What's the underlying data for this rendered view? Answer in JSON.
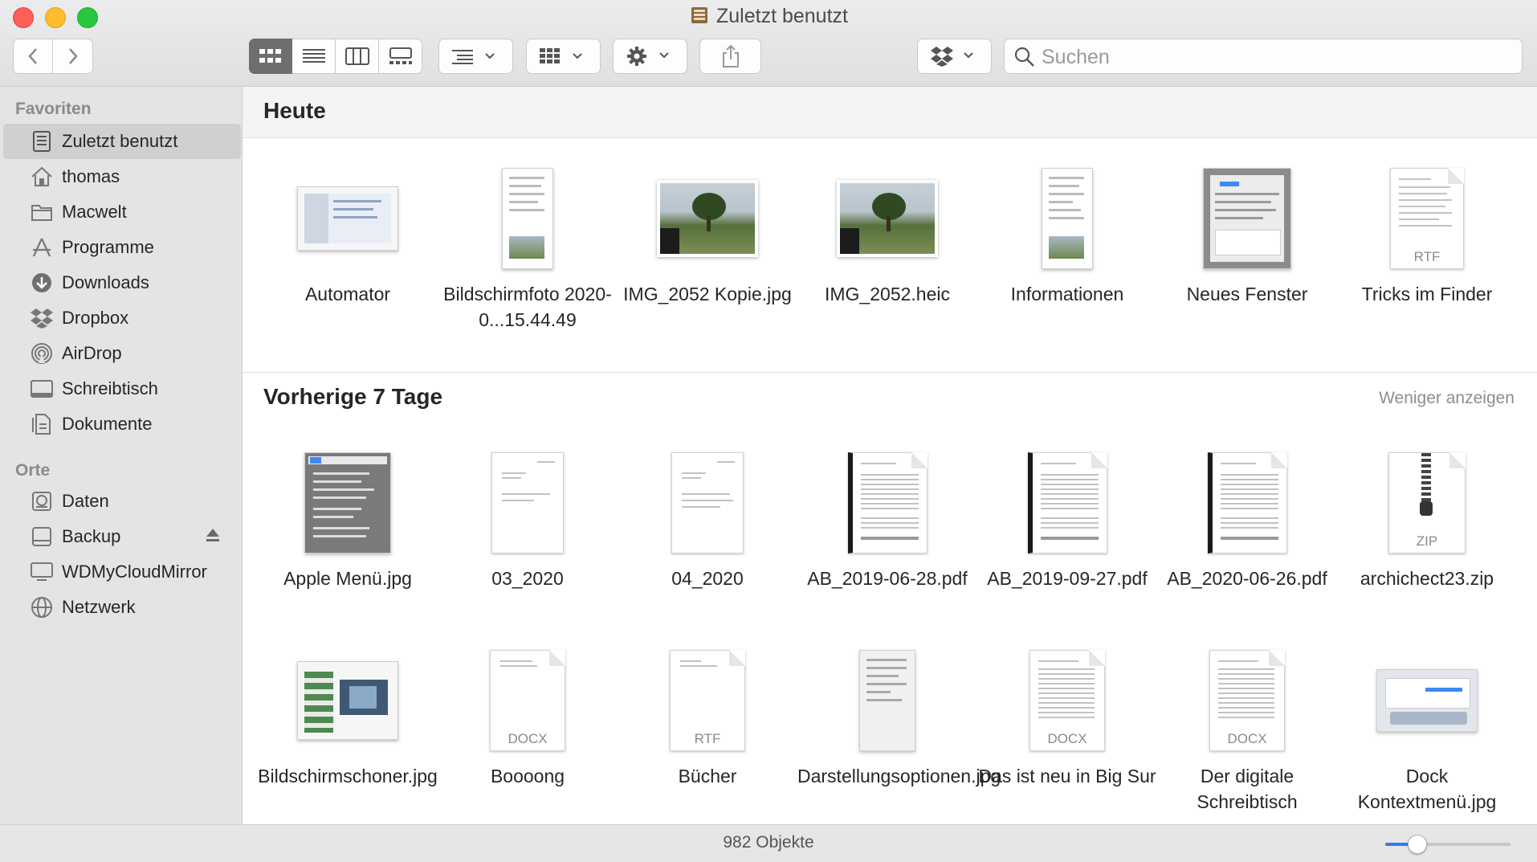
{
  "window": {
    "title": "Zuletzt benutzt"
  },
  "toolbar": {
    "back_icon": "chevron-left-icon",
    "forward_icon": "chevron-right-icon",
    "view_modes": [
      "icon-view",
      "list-view",
      "column-view",
      "gallery-view"
    ],
    "group_icon": "group-list-icon",
    "arrange_icon": "arrange-grid-icon",
    "action_icon": "gear-icon",
    "share_icon": "share-icon",
    "dropbox_icon": "dropbox-icon",
    "search_placeholder": "Suchen"
  },
  "sidebar": {
    "favorites_label": "Favoriten",
    "favorites": [
      {
        "label": "Zuletzt benutzt",
        "icon": "recents-icon",
        "selected": true
      },
      {
        "label": "thomas",
        "icon": "home-icon"
      },
      {
        "label": "Macwelt",
        "icon": "folder-icon"
      },
      {
        "label": "Programme",
        "icon": "applications-icon"
      },
      {
        "label": "Downloads",
        "icon": "downloads-icon"
      },
      {
        "label": "Dropbox",
        "icon": "dropbox-icon"
      },
      {
        "label": "AirDrop",
        "icon": "airdrop-icon"
      },
      {
        "label": "Schreibtisch",
        "icon": "desktop-icon"
      },
      {
        "label": "Dokumente",
        "icon": "documents-icon"
      }
    ],
    "locations_label": "Orte",
    "locations": [
      {
        "label": "Daten",
        "icon": "disk-icon"
      },
      {
        "label": "Backup",
        "icon": "external-disk-icon",
        "eject": true
      },
      {
        "label": "WDMyCloudMirror",
        "icon": "display-icon"
      },
      {
        "label": "Netzwerk",
        "icon": "network-icon"
      }
    ]
  },
  "sections": {
    "today": {
      "title": "Heute",
      "files": [
        {
          "name": "Automator",
          "kind": "screenshot-wide"
        },
        {
          "name": "Bildschirmfoto 2020-0...15.44.49",
          "kind": "screenshot-tall"
        },
        {
          "name": "IMG_2052 Kopie.jpg",
          "kind": "photo"
        },
        {
          "name": "IMG_2052.heic",
          "kind": "photo"
        },
        {
          "name": "Informationen",
          "kind": "screenshot-tall"
        },
        {
          "name": "Neues Fenster",
          "kind": "screenshot-dialog"
        },
        {
          "name": "Tricks im Finder",
          "kind": "document",
          "ext": "RTF"
        }
      ]
    },
    "previous": {
      "title": "Vorherige 7 Tage",
      "action": "Weniger anzeigen",
      "files": [
        {
          "name": "Apple Menü.jpg",
          "kind": "screenshot-menu"
        },
        {
          "name": "03_2020",
          "kind": "page"
        },
        {
          "name": "04_2020",
          "kind": "page"
        },
        {
          "name": "AB_2019-06-28.pdf",
          "kind": "pdf-spiral"
        },
        {
          "name": "AB_2019-09-27.pdf",
          "kind": "pdf-spiral"
        },
        {
          "name": "AB_2020-06-26.pdf",
          "kind": "pdf-spiral"
        },
        {
          "name": "archichect23.zip",
          "kind": "zip",
          "ext": "ZIP"
        },
        {
          "name": "Bildschirmschoner.jpg",
          "kind": "screenshot-wide"
        },
        {
          "name": "Boooong",
          "kind": "document",
          "ext": "DOCX"
        },
        {
          "name": "Bücher",
          "kind": "document",
          "ext": "RTF"
        },
        {
          "name": "Darstellungsoptionen.jpg",
          "kind": "screenshot-tall"
        },
        {
          "name": "Das ist neu in Big Sur",
          "kind": "document-text",
          "ext": "DOCX"
        },
        {
          "name": "Der digitale Schreibtisch",
          "kind": "document-text",
          "ext": "DOCX"
        },
        {
          "name": "Dock Kontextmenü.jpg",
          "kind": "screenshot-wide"
        }
      ]
    }
  },
  "status": {
    "count": "982 Objekte",
    "icon_size": 0.25
  },
  "colors": {
    "accent": "#2f7bf5",
    "selection": "#d0d0d0",
    "sidebar_bg": "#e4e4e4"
  }
}
